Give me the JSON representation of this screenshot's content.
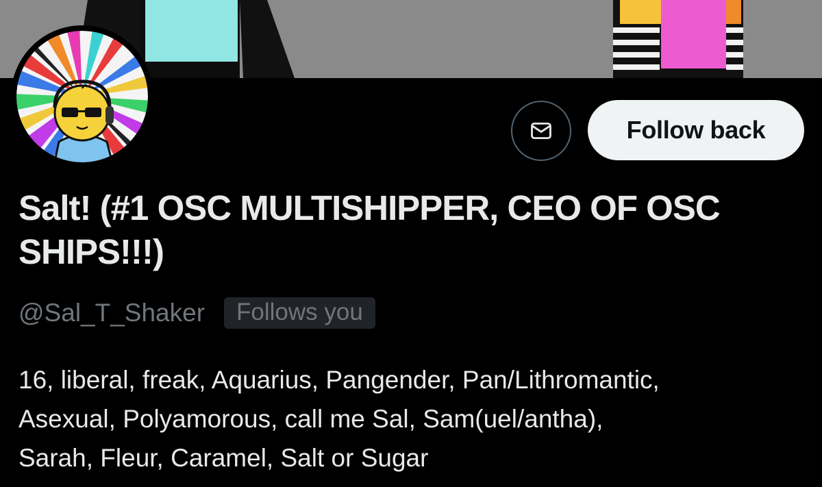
{
  "profile": {
    "display_name": "Salt! (#1 OSC MULTISHIPPER, CEO OF OSC SHIPS!!!)",
    "handle": "@Sal_T_Shaker",
    "follows_you_badge": "Follows you",
    "bio": "16, liberal, freak, Aquarius, Pangender, Pan/Lithromantic,\nAsexual, Polyamorous, call me Sal, Sam(uel/antha),\nSarah, Fleur, Caramel, Salt or Sugar"
  },
  "actions": {
    "message_icon": "envelope-icon",
    "follow_back_label": "Follow back"
  },
  "colors": {
    "background": "#000000",
    "text_primary": "#e7e9ea",
    "text_secondary": "#71767b",
    "follow_button_bg": "#eff3f4",
    "badge_bg": "#202327",
    "banner_gray": "#8b8b8b"
  }
}
